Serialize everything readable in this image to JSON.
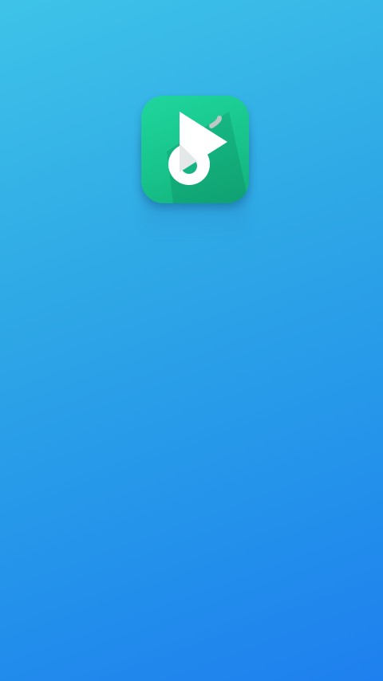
{
  "screen": {
    "type": "splash",
    "background_colors": [
      "#3ec3e8",
      "#2ea7e6",
      "#1e80ee"
    ]
  },
  "logo": {
    "icon": "play-music-note-icon",
    "tile_color": "#18c48b",
    "glyph_color": "#ffffff"
  }
}
